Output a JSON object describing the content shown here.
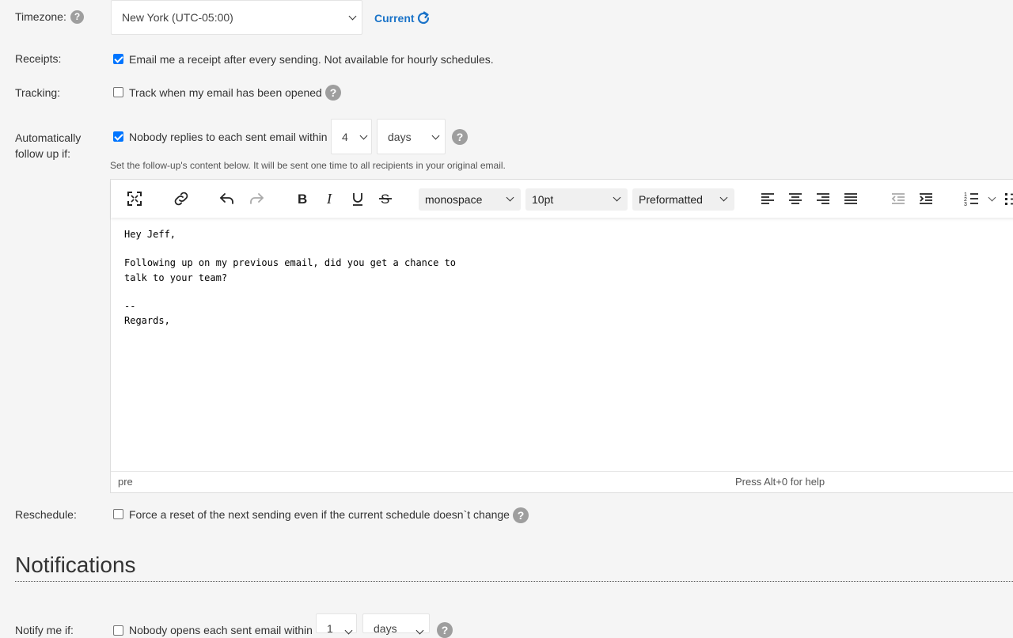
{
  "timezone": {
    "label": "Timezone:",
    "value": "New York (UTC-05:00)",
    "current_label": "Current"
  },
  "receipts": {
    "label": "Receipts:",
    "checked": true,
    "text": "Email me a receipt after every sending. Not available for hourly schedules."
  },
  "tracking": {
    "label": "Tracking:",
    "checked": false,
    "text": "Track when my email has been opened"
  },
  "followup": {
    "label_line1": "Automatically",
    "label_line2": "follow up if:",
    "checked": true,
    "text": "Nobody replies to each sent email within",
    "count": "4",
    "unit": "days",
    "hint": "Set the follow-up's content below. It will be sent one time to all recipients in your original email."
  },
  "editor": {
    "font_family": "monospace",
    "font_size": "10pt",
    "block_format": "Preformatted",
    "content": "Hey Jeff,\n\nFollowing up on my previous email, did you get a chance to\ntalk to your team?\n\n--\nRegards,",
    "status_path": "pre",
    "status_help": "Press Alt+0 for help"
  },
  "reschedule": {
    "label": "Reschedule:",
    "checked": false,
    "text": "Force a reset of the next sending even if the current schedule doesn`t change"
  },
  "notifications": {
    "title": "Notifications",
    "notify_label": "Notify me if:",
    "checked": false,
    "text": "Nobody opens each sent email within",
    "count": "1",
    "unit": "days"
  },
  "colors": {
    "accent": "#1a73c8",
    "checkbox": "#0075ff",
    "help_icon": "#9e9e9e"
  }
}
